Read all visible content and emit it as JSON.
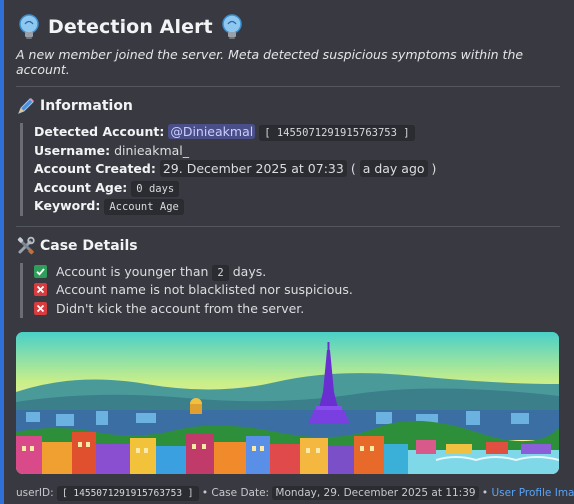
{
  "embed": {
    "accent_color": "#2f6fd8",
    "title": "Detection Alert",
    "title_icon": "light-bulb-icon",
    "description": "A new member joined the server. Meta detected suspicious symptoms within the account."
  },
  "information": {
    "heading": "Information",
    "icon": "pencil-icon",
    "detected_account_label": "Detected Account:",
    "mention": "@Dinieakmal",
    "user_id_code": "[ 1455071291915763753 ]",
    "username_label": "Username:",
    "username": "dinieakmal_",
    "created_label": "Account Created:",
    "created_value": "29. December 2025 at 07:33",
    "created_relative_open": "(",
    "created_relative": "a day ago",
    "created_relative_close": ")",
    "age_label": "Account Age:",
    "age_value": "0 days",
    "keyword_label": "Keyword:",
    "keyword_value": "Account Age"
  },
  "case_details": {
    "heading": "Case Details",
    "icon": "tools-icon",
    "items": [
      {
        "status": "pass",
        "icon": "check-icon",
        "text_before": "Account is younger than",
        "code": "2",
        "text_after": "days."
      },
      {
        "status": "fail",
        "icon": "cross-icon",
        "text": "Account name is not blacklisted nor suspicious."
      },
      {
        "status": "fail",
        "icon": "cross-icon",
        "text": "Didn't kick the account from the server."
      }
    ]
  },
  "image": {
    "subject": "pixel-art-paris-skyline"
  },
  "footer": {
    "user_id_label": "userID:",
    "user_id_code": "[ 1455071291915763753 ]",
    "case_date_label": "• Case Date:",
    "case_date": "Monday, 29. December 2025 at 11:39",
    "separator": "•",
    "link_label": "User Profile Image"
  }
}
